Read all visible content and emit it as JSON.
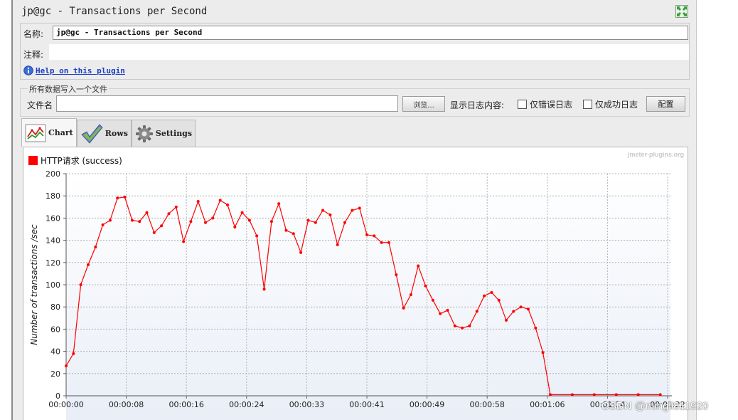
{
  "window": {
    "title": "jp@gc - Transactions per Second"
  },
  "name_field": {
    "label": "名称:",
    "value": "jp@gc - Transactions per Second"
  },
  "comment_field": {
    "label": "注释:",
    "value": ""
  },
  "help": {
    "icon": "info-icon",
    "link_text": "Help on this plugin"
  },
  "file_section": {
    "title": "所有数据写入一个文件",
    "file_label": "文件名",
    "file_value": "",
    "browse_label": "浏览...",
    "log_content_label": "显示日志内容:",
    "errors_only_label": "仅错误日志",
    "errors_only_checked": false,
    "success_only_label": "仅成功日志",
    "success_only_checked": false,
    "config_label": "配置"
  },
  "tabs": [
    {
      "label": "Chart",
      "icon": "chart-icon",
      "active": true
    },
    {
      "label": "Rows",
      "icon": "checkmark-icon",
      "active": false
    },
    {
      "label": "Settings",
      "icon": "gear-icon",
      "active": false
    }
  ],
  "colors": {
    "series": "#ff0000",
    "link": "#1a3cc4",
    "plot_background_bottom": "#e9eef7"
  },
  "chart_data": {
    "type": "line",
    "watermark": "jmeter-plugins.org",
    "ylabel": "Number of transactions /sec",
    "xlabel": "",
    "ylim": [
      0,
      200
    ],
    "yticks": [
      0,
      20,
      40,
      60,
      80,
      100,
      120,
      140,
      160,
      180,
      200
    ],
    "xticks": [
      "00:00:00",
      "00:00:08",
      "00:00:16",
      "00:00:24",
      "00:00:33",
      "00:00:41",
      "00:00:49",
      "00:00:58",
      "00:01:06",
      "00:01:14",
      "00:01:22"
    ],
    "grid": true,
    "legend": "top-left",
    "series": [
      {
        "name": "HTTP请求 (success)",
        "color": "#ff0000",
        "x_seconds": [
          0,
          1,
          2,
          3,
          4,
          5,
          6,
          7,
          8,
          9,
          10,
          11,
          12,
          13,
          14,
          15,
          16,
          17,
          18,
          19,
          20,
          21,
          22,
          23,
          24,
          25,
          26,
          27,
          28,
          29,
          30,
          31,
          32,
          33,
          34,
          35,
          36,
          37,
          38,
          39,
          40,
          41,
          42,
          43,
          44,
          45,
          46,
          47,
          48,
          49,
          50,
          51,
          52,
          53,
          54,
          55,
          56,
          57,
          58,
          59,
          60,
          61,
          62,
          63,
          64,
          65,
          66,
          69,
          72,
          75,
          78,
          81
        ],
        "values": [
          27,
          38,
          100,
          118,
          134,
          154,
          158,
          178,
          179,
          158,
          157,
          165,
          147,
          153,
          164,
          170,
          139,
          157,
          175,
          156,
          160,
          176,
          172,
          152,
          165,
          158,
          144,
          96,
          157,
          173,
          149,
          146,
          129,
          158,
          156,
          167,
          163,
          136,
          156,
          167,
          169,
          145,
          144,
          138,
          138,
          109,
          79,
          91,
          117,
          99,
          86,
          74,
          77,
          63,
          61,
          63,
          76,
          90,
          93,
          86,
          68,
          76,
          80,
          78,
          61,
          39,
          1,
          1,
          1,
          1,
          1,
          1
        ]
      }
    ]
  },
  "watermark_text": "CSDN @mingli811920"
}
